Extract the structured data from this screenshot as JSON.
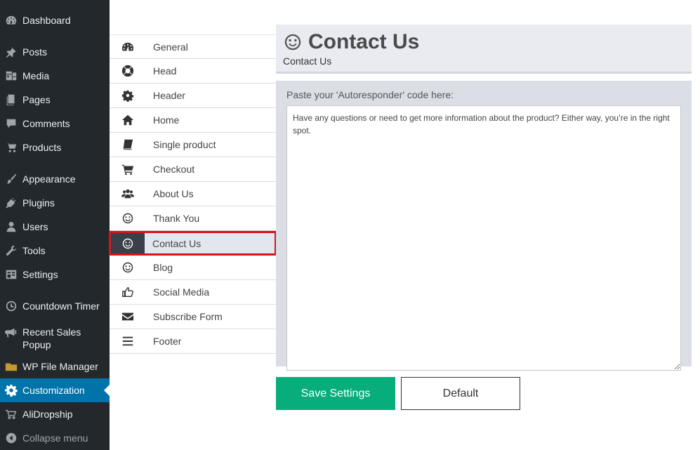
{
  "wp_menu": {
    "items": [
      {
        "label": "Dashboard",
        "icon": "dashboard-icon"
      },
      {
        "label": "Posts",
        "icon": "pin-icon"
      },
      {
        "label": "Media",
        "icon": "media-icon"
      },
      {
        "label": "Pages",
        "icon": "pages-icon"
      },
      {
        "label": "Comments",
        "icon": "comment-icon"
      },
      {
        "label": "Products",
        "icon": "cart-icon"
      },
      {
        "label": "Appearance",
        "icon": "brush-icon"
      },
      {
        "label": "Plugins",
        "icon": "plug-icon"
      },
      {
        "label": "Users",
        "icon": "user-icon"
      },
      {
        "label": "Tools",
        "icon": "wrench-icon"
      },
      {
        "label": "Settings",
        "icon": "settings-icon"
      },
      {
        "label": "Countdown Timer",
        "icon": "clock-icon"
      },
      {
        "label": "Recent Sales Popup",
        "icon": "megaphone-icon"
      },
      {
        "label": "WP File Manager",
        "icon": "folder-icon"
      },
      {
        "label": "Customization",
        "icon": "gear-icon"
      },
      {
        "label": "AliDropship",
        "icon": "dropship-cart-icon"
      },
      {
        "label": "Collapse menu",
        "icon": "collapse-icon"
      }
    ]
  },
  "plugin_menu": {
    "items": [
      {
        "label": "General",
        "icon": "speedometer-icon"
      },
      {
        "label": "Head",
        "icon": "lifebuoy-icon"
      },
      {
        "label": "Header",
        "icon": "gear-icon"
      },
      {
        "label": "Home",
        "icon": "home-icon"
      },
      {
        "label": "Single product",
        "icon": "book-icon"
      },
      {
        "label": "Checkout",
        "icon": "cart-icon"
      },
      {
        "label": "About Us",
        "icon": "users-icon"
      },
      {
        "label": "Thank You",
        "icon": "smiley-icon"
      },
      {
        "label": "Contact Us",
        "icon": "smiley-icon"
      },
      {
        "label": "Blog",
        "icon": "smiley-icon"
      },
      {
        "label": "Social Media",
        "icon": "thumbs-up-icon"
      },
      {
        "label": "Subscribe Form",
        "icon": "envelope-icon"
      },
      {
        "label": "Footer",
        "icon": "bars-icon"
      }
    ],
    "active": "Contact Us"
  },
  "main": {
    "title": "Contact Us",
    "subtitle": "Contact Us",
    "field_label": "Paste your 'Autoresponder' code here:",
    "field_value": "Have any questions or need to get more information about the product? Either way, you’re in the right spot.",
    "save_label": "Save Settings",
    "default_label": "Default"
  },
  "colors": {
    "sidebar_bg": "#23282d",
    "active_blue": "#0073aa",
    "save_green": "#08ad7c",
    "highlight_red": "#d0161b"
  }
}
